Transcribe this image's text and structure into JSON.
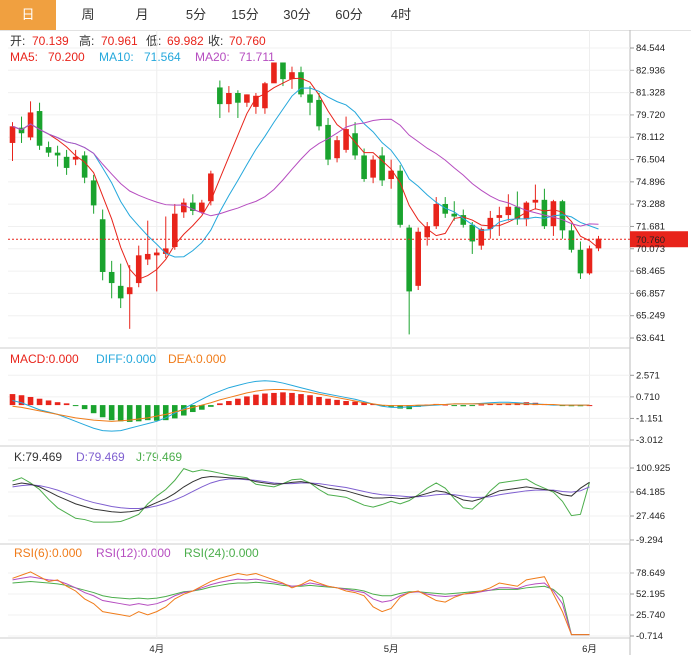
{
  "tabs": [
    {
      "label": "日",
      "active": true
    },
    {
      "label": "周",
      "active": false
    },
    {
      "label": "月",
      "active": false
    },
    {
      "label": "5分",
      "active": false
    },
    {
      "label": "15分",
      "active": false
    },
    {
      "label": "30分",
      "active": false
    },
    {
      "label": "60分",
      "active": false
    },
    {
      "label": "4时",
      "active": false
    }
  ],
  "header": {
    "ohlc": [
      {
        "k": "开:",
        "v": "70.139"
      },
      {
        "k": "高:",
        "v": "70.961"
      },
      {
        "k": "低:",
        "v": "69.982"
      },
      {
        "k": "收:",
        "v": "70.760"
      }
    ],
    "ma": [
      {
        "k": "MA5:",
        "v": "70.200"
      },
      {
        "k": "MA10:",
        "v": "71.564"
      },
      {
        "k": "MA20:",
        "v": "71.711"
      }
    ]
  },
  "macd_header": [
    {
      "k": "MACD:",
      "v": "0.000"
    },
    {
      "k": "DIFF:",
      "v": "0.000"
    },
    {
      "k": "DEA:",
      "v": "0.000"
    }
  ],
  "kdj_header": [
    {
      "k": "K:",
      "v": "79.469"
    },
    {
      "k": "D:",
      "v": "79.469"
    },
    {
      "k": "J:",
      "v": "79.469"
    }
  ],
  "rsi_header": [
    {
      "k": "RSI(6):",
      "v": "0.000"
    },
    {
      "k": "RSI(12):",
      "v": "0.000"
    },
    {
      "k": "RSI(24):",
      "v": "0.000"
    }
  ],
  "colors": {
    "up": "#e8241b",
    "down": "#1aa32e",
    "ma5": "#e8241b",
    "ma10": "#25a8dc",
    "ma20": "#b64dc0",
    "k": "#333333",
    "d": "#7f5fd0",
    "j": "#4cae4c",
    "rsi6": "#f07c1a",
    "rsi12": "#b64dc0",
    "rsi24": "#4cae4c",
    "diff": "#25a8dc",
    "dea": "#f07c1a",
    "tab_active": "#f0a040"
  },
  "chart_data": [
    {
      "type": "candlestick",
      "name": "price",
      "y_ticks": [
        "84.544",
        "82.936",
        "81.328",
        "79.720",
        "78.112",
        "76.504",
        "74.896",
        "73.288",
        "71.681",
        "70.073",
        "68.465",
        "66.857",
        "65.249",
        "63.641"
      ],
      "ylim": [
        63.641,
        84.544
      ],
      "current_price": "70.760",
      "x_ticks": [
        {
          "label": "4月",
          "index": 16
        },
        {
          "label": "5月",
          "index": 42
        },
        {
          "label": "6月",
          "index": 64
        }
      ],
      "candles": [
        {
          "o": 77.7,
          "h": 79.2,
          "l": 76.4,
          "c": 78.9
        },
        {
          "o": 78.8,
          "h": 79.6,
          "l": 77.7,
          "c": 78.4
        },
        {
          "o": 78.1,
          "h": 80.7,
          "l": 77.9,
          "c": 79.9
        },
        {
          "o": 80.0,
          "h": 80.6,
          "l": 77.2,
          "c": 77.5
        },
        {
          "o": 77.4,
          "h": 77.8,
          "l": 76.7,
          "c": 77.0
        },
        {
          "o": 77.0,
          "h": 77.5,
          "l": 76.0,
          "c": 76.8
        },
        {
          "o": 76.7,
          "h": 77.2,
          "l": 75.4,
          "c": 75.9
        },
        {
          "o": 76.5,
          "h": 77.2,
          "l": 76.1,
          "c": 76.7
        },
        {
          "o": 76.8,
          "h": 77.1,
          "l": 74.8,
          "c": 75.2
        },
        {
          "o": 75.0,
          "h": 75.4,
          "l": 72.6,
          "c": 73.2
        },
        {
          "o": 72.2,
          "h": 72.9,
          "l": 67.8,
          "c": 68.4
        },
        {
          "o": 68.4,
          "h": 69.2,
          "l": 66.5,
          "c": 67.6
        },
        {
          "o": 67.4,
          "h": 69.0,
          "l": 65.8,
          "c": 66.5
        },
        {
          "o": 66.8,
          "h": 68.9,
          "l": 64.3,
          "c": 67.3
        },
        {
          "o": 67.6,
          "h": 70.3,
          "l": 67.3,
          "c": 69.6
        },
        {
          "o": 69.3,
          "h": 72.1,
          "l": 68.9,
          "c": 69.7
        },
        {
          "o": 69.6,
          "h": 70.1,
          "l": 67.0,
          "c": 69.8
        },
        {
          "o": 69.7,
          "h": 72.4,
          "l": 69.4,
          "c": 70.1
        },
        {
          "o": 70.2,
          "h": 73.3,
          "l": 70.0,
          "c": 72.6
        },
        {
          "o": 72.7,
          "h": 73.7,
          "l": 72.3,
          "c": 73.4
        },
        {
          "o": 73.4,
          "h": 74.0,
          "l": 72.5,
          "c": 72.8
        },
        {
          "o": 72.7,
          "h": 73.6,
          "l": 72.6,
          "c": 73.4
        },
        {
          "o": 73.5,
          "h": 75.7,
          "l": 73.2,
          "c": 75.5
        },
        {
          "o": 81.7,
          "h": 82.2,
          "l": 79.5,
          "c": 80.5
        },
        {
          "o": 80.5,
          "h": 81.8,
          "l": 79.9,
          "c": 81.3
        },
        {
          "o": 81.3,
          "h": 81.5,
          "l": 79.5,
          "c": 80.6
        },
        {
          "o": 80.6,
          "h": 81.2,
          "l": 80.3,
          "c": 81.2
        },
        {
          "o": 80.3,
          "h": 81.3,
          "l": 79.8,
          "c": 81.1
        },
        {
          "o": 80.2,
          "h": 82.1,
          "l": 79.8,
          "c": 82.0
        },
        {
          "o": 82.0,
          "h": 83.1,
          "l": 82.2,
          "c": 83.5
        },
        {
          "o": 83.5,
          "h": 83.5,
          "l": 81.8,
          "c": 82.3
        },
        {
          "o": 82.3,
          "h": 83.2,
          "l": 81.6,
          "c": 82.8
        },
        {
          "o": 82.8,
          "h": 83.2,
          "l": 81.0,
          "c": 81.2
        },
        {
          "o": 81.2,
          "h": 81.8,
          "l": 79.7,
          "c": 80.6
        },
        {
          "o": 80.8,
          "h": 81.3,
          "l": 78.6,
          "c": 78.9
        },
        {
          "o": 79.0,
          "h": 79.5,
          "l": 76.1,
          "c": 76.5
        },
        {
          "o": 76.6,
          "h": 78.2,
          "l": 76.3,
          "c": 77.9
        },
        {
          "o": 77.2,
          "h": 79.6,
          "l": 77.0,
          "c": 78.7
        },
        {
          "o": 78.4,
          "h": 79.2,
          "l": 76.5,
          "c": 76.8
        },
        {
          "o": 76.8,
          "h": 77.3,
          "l": 74.9,
          "c": 75.1
        },
        {
          "o": 75.2,
          "h": 76.8,
          "l": 74.8,
          "c": 76.5
        },
        {
          "o": 76.8,
          "h": 77.4,
          "l": 74.6,
          "c": 75.0
        },
        {
          "o": 75.1,
          "h": 76.5,
          "l": 74.4,
          "c": 75.7
        },
        {
          "o": 75.7,
          "h": 76.1,
          "l": 71.6,
          "c": 71.8
        },
        {
          "o": 71.6,
          "h": 71.8,
          "l": 63.9,
          "c": 67.0
        },
        {
          "o": 67.4,
          "h": 71.6,
          "l": 67.1,
          "c": 71.3
        },
        {
          "o": 70.9,
          "h": 72.0,
          "l": 70.3,
          "c": 71.7
        },
        {
          "o": 71.7,
          "h": 73.8,
          "l": 71.5,
          "c": 73.3
        },
        {
          "o": 73.3,
          "h": 73.8,
          "l": 72.3,
          "c": 72.6
        },
        {
          "o": 72.6,
          "h": 73.5,
          "l": 72.1,
          "c": 72.4
        },
        {
          "o": 72.5,
          "h": 72.9,
          "l": 71.6,
          "c": 71.8
        },
        {
          "o": 71.8,
          "h": 72.0,
          "l": 69.7,
          "c": 70.6
        },
        {
          "o": 70.3,
          "h": 71.6,
          "l": 70.0,
          "c": 71.5
        },
        {
          "o": 71.5,
          "h": 72.8,
          "l": 70.8,
          "c": 72.3
        },
        {
          "o": 72.3,
          "h": 73.1,
          "l": 71.0,
          "c": 72.5
        },
        {
          "o": 72.5,
          "h": 74.0,
          "l": 72.1,
          "c": 73.1
        },
        {
          "o": 73.1,
          "h": 74.2,
          "l": 71.8,
          "c": 72.2
        },
        {
          "o": 72.2,
          "h": 73.5,
          "l": 71.7,
          "c": 73.4
        },
        {
          "o": 73.4,
          "h": 74.7,
          "l": 72.9,
          "c": 73.6
        },
        {
          "o": 73.6,
          "h": 74.4,
          "l": 71.5,
          "c": 71.7
        },
        {
          "o": 71.7,
          "h": 73.6,
          "l": 71.0,
          "c": 73.5
        },
        {
          "o": 73.5,
          "h": 73.6,
          "l": 70.8,
          "c": 71.4
        },
        {
          "o": 71.4,
          "h": 71.9,
          "l": 69.8,
          "c": 70.0
        },
        {
          "o": 70.0,
          "h": 70.6,
          "l": 67.9,
          "c": 68.3
        },
        {
          "o": 68.3,
          "h": 70.3,
          "l": 68.2,
          "c": 70.1
        },
        {
          "o": 70.1,
          "h": 71.0,
          "l": 69.9,
          "c": 70.8
        }
      ]
    },
    {
      "type": "bar",
      "name": "macd",
      "y_ticks": [
        "2.571",
        "0.710",
        "-1.151",
        "-3.012"
      ],
      "ylim": [
        -3.012,
        3.2
      ],
      "values": [
        0.95,
        0.85,
        0.7,
        0.55,
        0.4,
        0.25,
        0.15,
        -0.05,
        -0.35,
        -0.7,
        -1.05,
        -1.3,
        -1.4,
        -1.45,
        -1.4,
        -1.3,
        -1.35,
        -1.3,
        -1.15,
        -0.9,
        -0.6,
        -0.4,
        -0.15,
        0.15,
        0.35,
        0.55,
        0.75,
        0.9,
        1.0,
        1.05,
        1.1,
        1.05,
        0.95,
        0.85,
        0.7,
        0.55,
        0.45,
        0.35,
        0.3,
        0.25,
        0.1,
        -0.05,
        -0.15,
        -0.3,
        -0.35,
        -0.15,
        0.05,
        0.1,
        0.05,
        -0.05,
        -0.1,
        -0.05,
        0.05,
        0.1,
        0.1,
        0.15,
        0.2,
        0.25,
        0.2,
        0.1,
        0.05,
        -0.05,
        -0.1,
        -0.1,
        0.0
      ],
      "diff": [
        0.4,
        0.2,
        -0.1,
        -0.4,
        -0.6,
        -0.8,
        -1.1,
        -1.4,
        -1.7,
        -2.0,
        -2.2,
        -2.25,
        -2.2,
        -2.0,
        -1.8,
        -1.6,
        -1.4,
        -1.1,
        -0.7,
        -0.3,
        0.1,
        0.5,
        0.9,
        1.2,
        1.5,
        1.7,
        1.9,
        2.05,
        2.1,
        2.05,
        1.9,
        1.7,
        1.5,
        1.3,
        1.1,
        0.95,
        0.8,
        0.65,
        0.5,
        0.3,
        0.1,
        -0.1,
        -0.2,
        -0.2,
        -0.15,
        -0.1,
        -0.05,
        0.0,
        0.05,
        0.1,
        0.1,
        0.1,
        0.15,
        0.2,
        0.25,
        0.25,
        0.2,
        0.15,
        0.1,
        0.05,
        0.0,
        0.0,
        0.0,
        0.0,
        0.0
      ],
      "dea": [
        -0.1,
        -0.2,
        -0.35,
        -0.5,
        -0.65,
        -0.8,
        -0.95,
        -1.1,
        -1.2,
        -1.3,
        -1.35,
        -1.4,
        -1.35,
        -1.3,
        -1.2,
        -1.1,
        -0.95,
        -0.8,
        -0.6,
        -0.4,
        -0.2,
        0.0,
        0.2,
        0.45,
        0.65,
        0.85,
        1.05,
        1.2,
        1.3,
        1.35,
        1.35,
        1.3,
        1.2,
        1.1,
        0.95,
        0.8,
        0.65,
        0.5,
        0.35,
        0.2,
        0.1,
        0.0,
        -0.05,
        -0.05,
        -0.05,
        0.0,
        0.0,
        0.05,
        0.05,
        0.1,
        0.1,
        0.1,
        0.1,
        0.1,
        0.1,
        0.1,
        0.1,
        0.1,
        0.05,
        0.05,
        0.05,
        0.0,
        0.0,
        0.0,
        0.0
      ]
    },
    {
      "type": "line",
      "name": "kdj",
      "y_ticks": [
        "100.925",
        "64.185",
        "27.446",
        "-9.294"
      ],
      "ylim": [
        -9.294,
        100.925
      ],
      "k": [
        75,
        78,
        76,
        72,
        65,
        58,
        52,
        46,
        42,
        38,
        36,
        34,
        33,
        34,
        36,
        42,
        48,
        54,
        62,
        72,
        80,
        86,
        88,
        87,
        86,
        85,
        84,
        80,
        78,
        76,
        77,
        79,
        80,
        78,
        74,
        70,
        68,
        66,
        62,
        58,
        55,
        55,
        56,
        54,
        55,
        58,
        62,
        66,
        64,
        58,
        52,
        50,
        54,
        60,
        66,
        68,
        70,
        72,
        70,
        68,
        66,
        60,
        58,
        70,
        79
      ],
      "d": [
        72,
        74,
        75,
        74,
        71,
        67,
        62,
        57,
        52,
        48,
        45,
        42,
        40,
        39,
        39,
        40,
        43,
        47,
        52,
        58,
        65,
        72,
        78,
        82,
        84,
        84,
        83,
        82,
        80,
        78,
        77,
        77,
        78,
        78,
        77,
        75,
        73,
        71,
        68,
        65,
        62,
        60,
        59,
        58,
        57,
        57,
        58,
        60,
        61,
        60,
        58,
        56,
        56,
        57,
        60,
        62,
        64,
        66,
        67,
        67,
        67,
        65,
        64,
        66,
        72
      ],
      "j": [
        81,
        86,
        78,
        68,
        53,
        40,
        32,
        24,
        22,
        18,
        18,
        18,
        19,
        24,
        30,
        46,
        58,
        68,
        82,
        100,
        95,
        98,
        96,
        93,
        90,
        88,
        86,
        76,
        74,
        72,
        77,
        83,
        84,
        78,
        68,
        60,
        58,
        56,
        50,
        44,
        41,
        45,
        50,
        46,
        51,
        60,
        70,
        78,
        70,
        54,
        40,
        38,
        50,
        66,
        78,
        80,
        82,
        84,
        76,
        70,
        64,
        50,
        28,
        30,
        79
      ]
    },
    {
      "type": "line",
      "name": "rsi",
      "y_ticks": [
        "78.649",
        "52.195",
        "25.740",
        "-0.714"
      ],
      "ylim": [
        -0.714,
        90
      ],
      "rsi6": [
        72,
        76,
        80,
        74,
        68,
        70,
        62,
        56,
        46,
        40,
        30,
        28,
        26,
        24,
        30,
        26,
        30,
        36,
        46,
        52,
        56,
        62,
        68,
        72,
        75,
        78,
        76,
        78,
        74,
        70,
        66,
        60,
        64,
        70,
        66,
        62,
        60,
        56,
        54,
        50,
        36,
        30,
        34,
        48,
        54,
        56,
        50,
        44,
        42,
        48,
        52,
        54,
        56,
        60,
        66,
        64,
        62,
        70,
        72,
        74,
        52,
        30,
        1,
        1,
        1
      ],
      "rsi12": [
        70,
        72,
        74,
        72,
        70,
        69,
        65,
        60,
        54,
        50,
        44,
        42,
        40,
        38,
        40,
        38,
        40,
        44,
        50,
        54,
        56,
        60,
        64,
        67,
        69,
        71,
        70,
        71,
        69,
        67,
        65,
        62,
        63,
        66,
        64,
        62,
        60,
        58,
        56,
        54,
        46,
        42,
        44,
        50,
        54,
        55,
        52,
        50,
        49,
        50,
        52,
        53,
        55,
        57,
        60,
        60,
        59,
        63,
        65,
        66,
        56,
        40,
        1,
        1,
        1
      ],
      "rsi24": [
        66,
        67,
        68,
        67,
        66,
        65,
        63,
        60,
        57,
        54,
        50,
        48,
        47,
        46,
        47,
        46,
        47,
        49,
        52,
        55,
        56,
        58,
        61,
        63,
        65,
        66,
        66,
        67,
        66,
        65,
        63,
        62,
        62,
        63,
        62,
        61,
        60,
        59,
        58,
        56,
        52,
        50,
        50,
        53,
        55,
        55,
        54,
        53,
        52,
        53,
        54,
        55,
        56,
        57,
        58,
        58,
        58,
        60,
        61,
        62,
        58,
        48,
        1,
        1,
        1
      ]
    }
  ]
}
